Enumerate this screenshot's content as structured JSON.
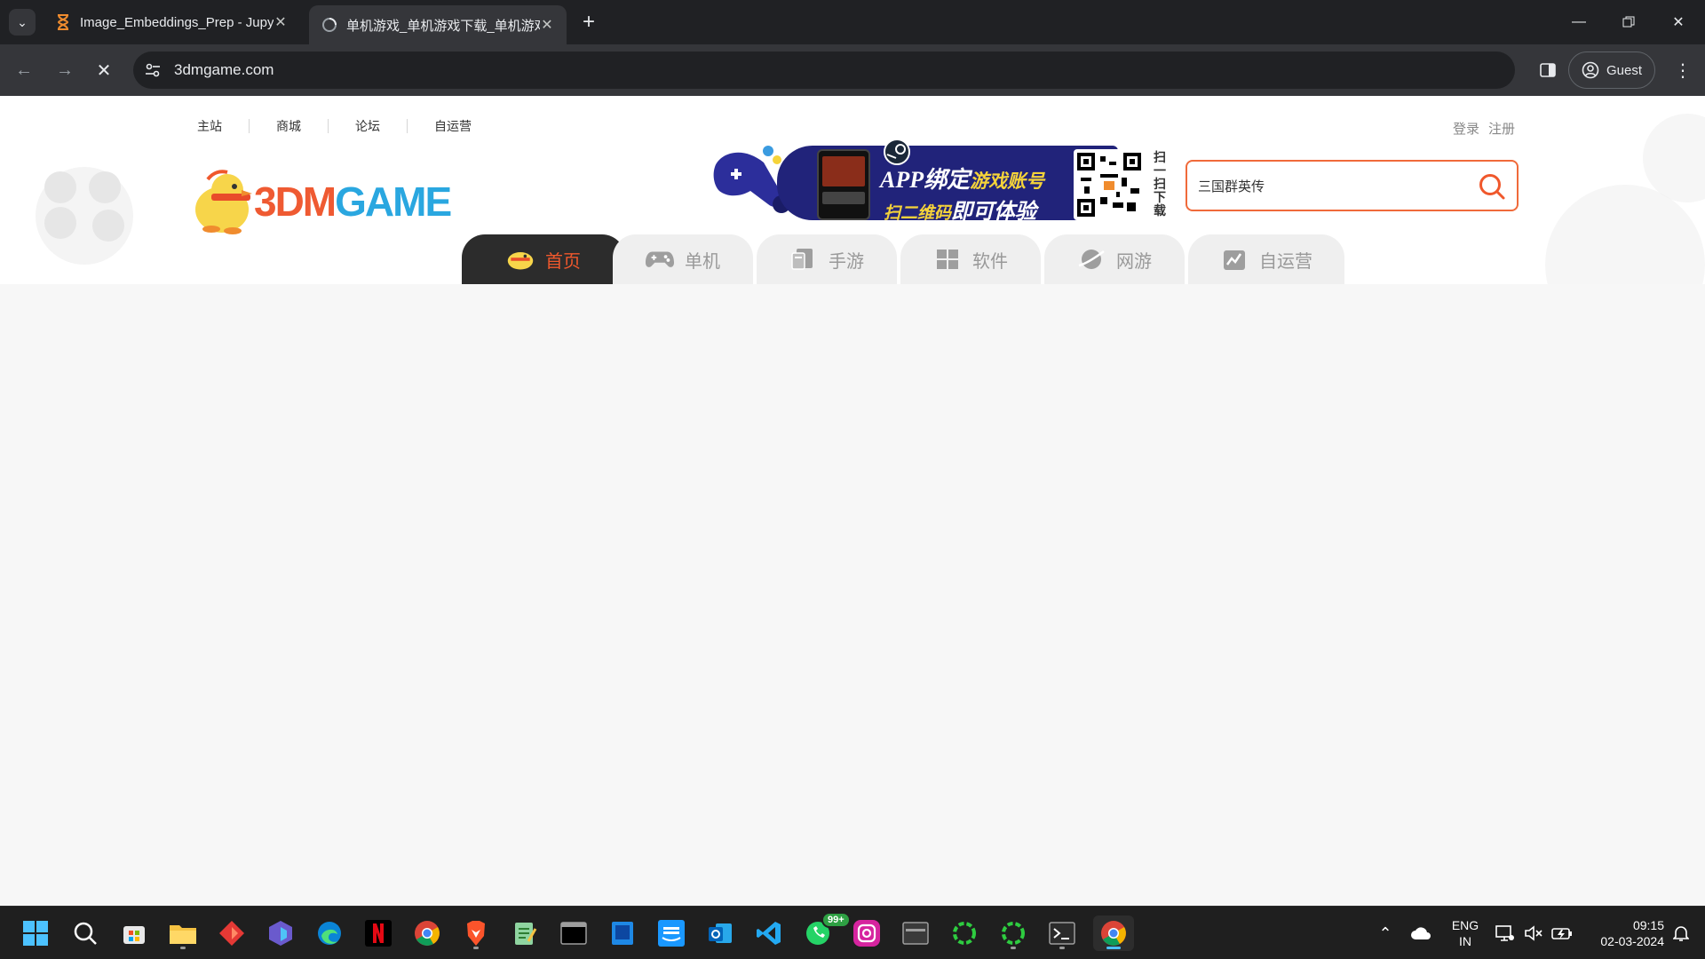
{
  "browser": {
    "tabs": [
      {
        "title": "Image_Embeddings_Prep - Jupyter",
        "favicon": "hourglass-icon"
      },
      {
        "title": "单机游戏_单机游戏下载_单机游戏",
        "favicon": "loading-globe-icon"
      }
    ],
    "url": "3dmgame.com",
    "profile_label": "Guest"
  },
  "site": {
    "topnav": [
      "主站",
      "商城",
      "论坛",
      "自运营"
    ],
    "auth": {
      "login": "登录",
      "register": "注册"
    },
    "logo": {
      "part1": "3DM",
      "part2": "GAME"
    },
    "banner": {
      "title_main": "APP绑定",
      "title_hl": "游戏账号",
      "sub_hl": "扫二维码",
      "sub_main": "即可体验",
      "side_text": "扫一扫下载"
    },
    "search": {
      "value": "三国群英传"
    },
    "nav_tabs": [
      {
        "label": "首页",
        "icon": "chick-icon"
      },
      {
        "label": "单机",
        "icon": "gamepad-icon"
      },
      {
        "label": "手游",
        "icon": "mobile-icon"
      },
      {
        "label": "软件",
        "icon": "windows-icon"
      },
      {
        "label": "网游",
        "icon": "planet-icon"
      },
      {
        "label": "自运营",
        "icon": "chart-icon"
      }
    ]
  },
  "taskbar": {
    "apps": [
      "start-icon",
      "search-icon",
      "store-icon",
      "file-explorer-icon",
      "app-red-icon",
      "app-purple-icon",
      "edge-icon",
      "netflix-icon",
      "chrome-icon",
      "brave-icon",
      "notepad-icon",
      "terminal-icon",
      "app-blue-icon",
      "prime-video-icon",
      "outlook-icon",
      "vscode-icon",
      "whatsapp-icon",
      "instagram-icon",
      "app-window-icon",
      "app-green-ring-icon",
      "app-green-ring2-icon",
      "powershell-icon",
      "chrome-active-icon"
    ],
    "whatsapp_badge": "99+",
    "lang_line1": "ENG",
    "lang_line2": "IN",
    "time": "09:15",
    "date": "02-03-2024"
  },
  "colors": {
    "accent": "#f0582c",
    "search_border": "#f06a3a",
    "logo_blue": "#2aa7e0",
    "logo_orange": "#ef5a32",
    "banner_bg": "#21237a"
  }
}
